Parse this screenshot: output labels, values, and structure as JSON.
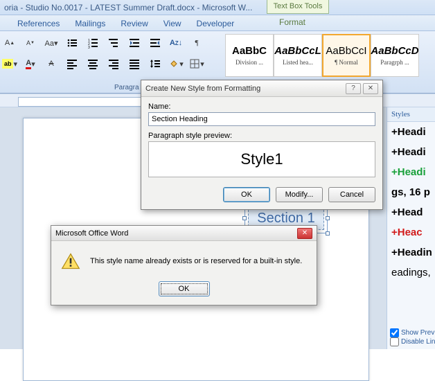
{
  "window": {
    "title": "oria - Studio No.0017 - LATEST Summer Draft.docx - Microsoft W...",
    "contextual_tab_group": "Text Box Tools"
  },
  "ribbon_tabs": {
    "references": "References",
    "mailings": "Mailings",
    "review": "Review",
    "view": "View",
    "developer": "Developer",
    "format": "Format"
  },
  "ribbon": {
    "paragraph_group_label": "Paragra",
    "style_gallery": [
      {
        "sample": "AaBbC",
        "label": "Division ...",
        "bold": true,
        "serif": true
      },
      {
        "sample": "AaBbCcL",
        "label": "Listed hea...",
        "bold": true,
        "italic": true,
        "serif": true
      },
      {
        "sample": "AaBbCcI",
        "label": "¶ Normal",
        "bold": false,
        "serif": true,
        "selected": true
      },
      {
        "sample": "AaBbCcD",
        "label": "Paragrph ...",
        "bold": true,
        "italic": true,
        "serif": true
      }
    ]
  },
  "document": {
    "textbox_content": "Section 1"
  },
  "styles_pane": {
    "title": "Styles",
    "items": [
      {
        "text": "+Headi",
        "color": "#000000"
      },
      {
        "text": "+Headi",
        "color": "#000000"
      },
      {
        "text": "+Headi",
        "color": "#19a03a"
      },
      {
        "text": "gs, 16 p",
        "color": "#000000"
      },
      {
        "text": "+Head",
        "color": "#000000"
      },
      {
        "text": "+Heac",
        "color": "#d11a1a"
      },
      {
        "text": "+Headin",
        "color": "#000000"
      },
      {
        "text": "eadings,",
        "color": "#000000",
        "weight": "normal"
      }
    ],
    "show_preview": "Show Previ",
    "disable_linked": "Disable Link",
    "show_preview_checked": true,
    "disable_linked_checked": false
  },
  "create_style_dialog": {
    "title": "Create New Style from Formatting",
    "name_label": "Name:",
    "name_value": "Section Heading",
    "preview_label": "Paragraph style preview:",
    "preview_text": "Style1",
    "ok": "OK",
    "modify": "Modify...",
    "cancel": "Cancel"
  },
  "message_box": {
    "title": "Microsoft Office Word",
    "text": "This style name already exists or is reserved for a built-in style.",
    "ok": "OK"
  }
}
